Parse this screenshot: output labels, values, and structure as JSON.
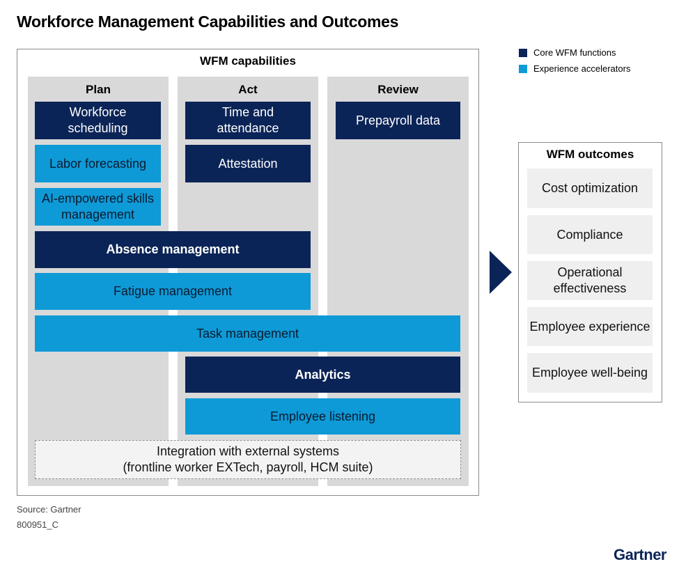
{
  "title": "Workforce Management Capabilities and Outcomes",
  "legend": {
    "core": {
      "label": "Core WFM functions",
      "color": "#0b2457"
    },
    "accelerator": {
      "label": "Experience accelerators",
      "color": "#0e9ad7"
    }
  },
  "capabilities": {
    "title": "WFM capabilities",
    "columns": [
      "Plan",
      "Act",
      "Review"
    ],
    "items": {
      "workforce_scheduling": "Workforce scheduling",
      "labor_forecasting": "Labor forecasting",
      "ai_skills": "AI-empowered skills management",
      "time_attendance": "Time and attendance",
      "attestation": "Attestation",
      "prepayroll": "Prepayroll data",
      "absence": "Absence management",
      "fatigue": "Fatigue management",
      "task": "Task management",
      "analytics": "Analytics",
      "listening": "Employee listening",
      "integration_line1": "Integration with external systems",
      "integration_line2": "(frontline worker EXTech, payroll, HCM suite)"
    }
  },
  "outcomes": {
    "title": "WFM outcomes",
    "items": [
      "Cost optimization",
      "Compliance",
      "Operational effectiveness",
      "Employee experience",
      "Employee well-being"
    ]
  },
  "footer": {
    "source": "Source: Gartner",
    "id": "800951_C",
    "brand": "Gartner"
  }
}
